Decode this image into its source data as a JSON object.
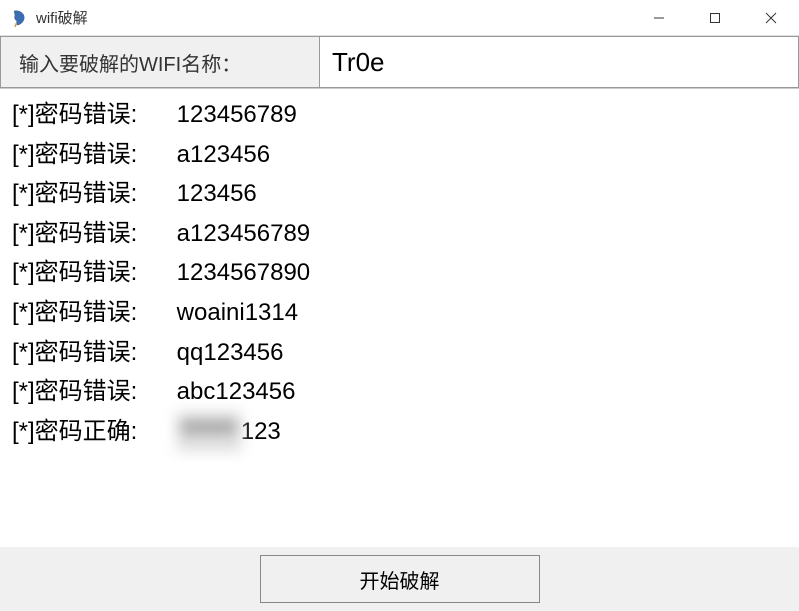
{
  "window": {
    "title": "wifi破解"
  },
  "input": {
    "label": "输入要破解的WIFI名称：",
    "value": "Tr0e"
  },
  "log": {
    "prefix": "[*]",
    "wrong_label": "密码错误:",
    "correct_label": "密码正确:",
    "lines": [
      {
        "status": "wrong",
        "pw": "123456789"
      },
      {
        "status": "wrong",
        "pw": "a123456"
      },
      {
        "status": "wrong",
        "pw": "123456"
      },
      {
        "status": "wrong",
        "pw": "a123456789"
      },
      {
        "status": "wrong",
        "pw": "1234567890"
      },
      {
        "status": "wrong",
        "pw": "woaini1314"
      },
      {
        "status": "wrong",
        "pw": "qq123456"
      },
      {
        "status": "wrong",
        "pw": "abc123456"
      },
      {
        "status": "correct",
        "pw_hidden": "******",
        "pw_tail": "123"
      }
    ]
  },
  "button": {
    "start": "开始破解"
  }
}
